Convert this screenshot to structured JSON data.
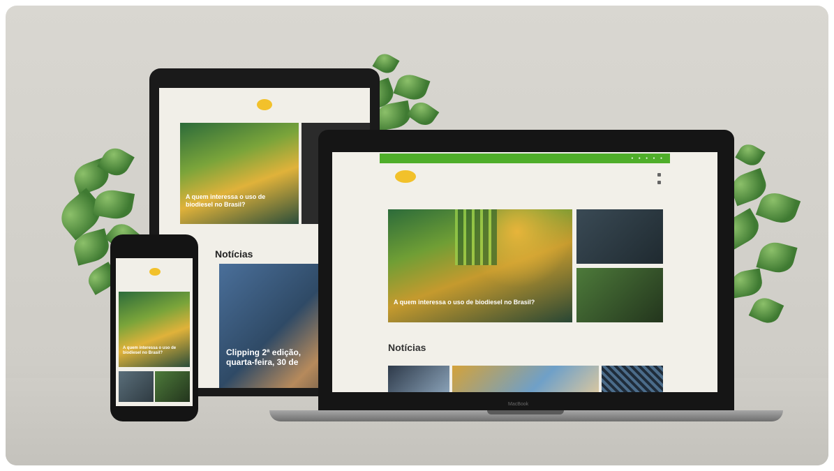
{
  "laptop": {
    "topbar": "",
    "logo_text": "",
    "nav": "",
    "hero_title": "A quem interessa o uso de biodiesel no Brasil?",
    "section_title": "Notícias",
    "brand": "MacBook"
  },
  "tablet": {
    "hero_title": "A quem interessa o uso de biodiesel no Brasil?",
    "section_title": "Notícias",
    "card_title": "Clipping 2ª edição, quarta-feira, 30 de"
  },
  "phone": {
    "hero_title": "A quem interessa o uso de biodiesel no Brasil?"
  }
}
